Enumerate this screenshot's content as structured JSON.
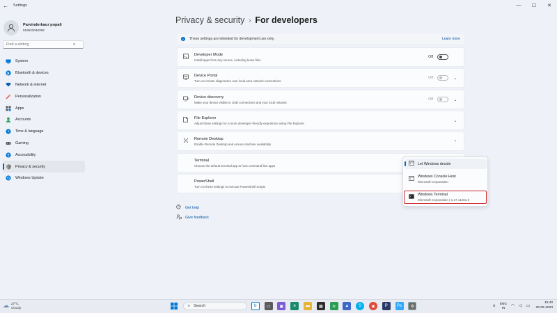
{
  "window": {
    "back_glyph": "←",
    "title": "Settings",
    "controls": [
      "—",
      "☐",
      "✕"
    ]
  },
  "user": {
    "name": "Parvinderkaur popali",
    "phone": "918623046399"
  },
  "search": {
    "placeholder": "Find a setting"
  },
  "sidebar": {
    "items": [
      {
        "label": "System",
        "icon": "system-icon",
        "color": "#0078d4"
      },
      {
        "label": "Bluetooth & devices",
        "icon": "bluetooth-icon",
        "color": "#0078d4"
      },
      {
        "label": "Network & internet",
        "icon": "network-icon",
        "color": "#0a5ea8"
      },
      {
        "label": "Personalization",
        "icon": "brush-icon",
        "color": "#d9534f"
      },
      {
        "label": "Apps",
        "icon": "apps-icon",
        "color": "#555555"
      },
      {
        "label": "Accounts",
        "icon": "accounts-icon",
        "color": "#2aa15e"
      },
      {
        "label": "Time & language",
        "icon": "clock-icon",
        "color": "#0078d4"
      },
      {
        "label": "Gaming",
        "icon": "gamepad-icon",
        "color": "#555555"
      },
      {
        "label": "Accessibility",
        "icon": "accessibility-icon",
        "color": "#0078d4"
      },
      {
        "label": "Privacy & security",
        "icon": "shield-icon",
        "color": "#777777"
      },
      {
        "label": "Windows Update",
        "icon": "update-icon",
        "color": "#0078d4"
      }
    ],
    "active_index": 9
  },
  "breadcrumb": {
    "parent": "Privacy & security",
    "separator": "›",
    "current": "For developers"
  },
  "banner": {
    "text": "These settings are intended for development use only.",
    "link": "Learn more"
  },
  "cards": {
    "developer_mode": {
      "title": "Developer Mode",
      "desc": "Install apps from any source, including loose files",
      "state": "Off"
    },
    "device_portal": {
      "title": "Device Portal",
      "desc": "Turn on remote diagnostics over local area network connections",
      "state": "Off"
    },
    "device_discovery": {
      "title": "Device discovery",
      "desc": "Make your device visible to USB connections and your local network",
      "state": "Off"
    },
    "file_explorer": {
      "title": "File Explorer",
      "desc": "Adjust these settings for a more developer-friendly experience using File Explorer"
    },
    "remote_desktop": {
      "title": "Remote Desktop",
      "desc": "Enable Remote Desktop and ensure machine availability"
    },
    "terminal": {
      "title": "Terminal",
      "desc": "Choose the default terminal app to host command-line apps"
    },
    "powershell": {
      "title": "PowerShell",
      "desc": "Turn on these settings to execute PowerShell scripts"
    }
  },
  "terminal_menu": {
    "options": [
      {
        "title": "Let Windows decide",
        "sub": ""
      },
      {
        "title": "Windows Console Host",
        "sub": "Microsoft Corporation"
      },
      {
        "title": "Windows Terminal",
        "sub": "Microsoft Corporation  |  1.17.11461.0"
      }
    ]
  },
  "links": {
    "help": "Get help",
    "feedback": "Give feedback"
  },
  "taskbar": {
    "weather_temp": "27°C",
    "weather_cond": "Cloudy",
    "search_placeholder": "Search",
    "lang_top": "ENG",
    "lang_bottom": "IN",
    "time": "15:40",
    "date": "30-06-2023"
  }
}
